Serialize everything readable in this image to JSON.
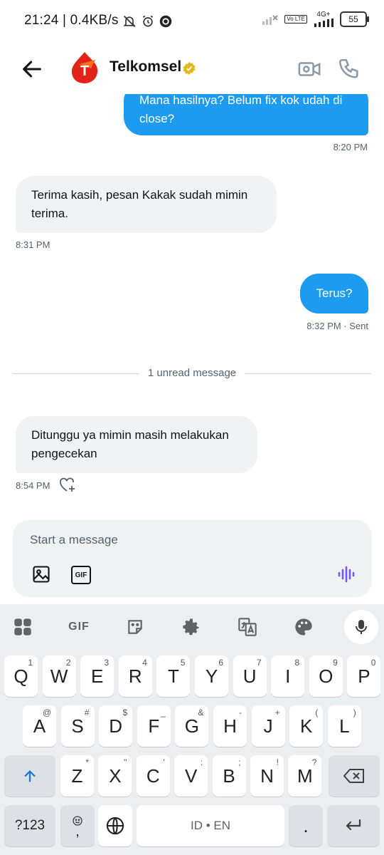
{
  "status_bar": {
    "time": "21:24",
    "speed": "0.4KB/s",
    "volte": "Vo LTE",
    "network": "4G+",
    "battery": "55"
  },
  "header": {
    "title": "Telkomsel",
    "avatar_letter": "T",
    "icons": {
      "back": "back-arrow-icon",
      "video": "video-icon",
      "call": "phone-icon",
      "verified": "verified-badge-icon"
    }
  },
  "messages": [
    {
      "direction": "out",
      "text": "Mana hasilnya? Belum fix kok udah di close?",
      "time": "8:20 PM"
    },
    {
      "direction": "in",
      "text": "Terima kasih, pesan Kakak sudah mimin terima.",
      "time": "8:31 PM"
    },
    {
      "direction": "out",
      "text": "Terus?",
      "time": "8:32 PM · Sent"
    },
    {
      "direction": "in",
      "text": "Ditunggu ya mimin masih melakukan pengecekan",
      "time": "8:54 PM"
    }
  ],
  "unread_divider": "1 unread message",
  "composer": {
    "placeholder": "Start a message",
    "gif_label": "GIF"
  },
  "keyboard": {
    "toolbar_gif": "GIF",
    "row1": [
      {
        "k": "Q",
        "h": "1"
      },
      {
        "k": "W",
        "h": "2"
      },
      {
        "k": "E",
        "h": "3"
      },
      {
        "k": "R",
        "h": "4"
      },
      {
        "k": "T",
        "h": "5"
      },
      {
        "k": "Y",
        "h": "6"
      },
      {
        "k": "U",
        "h": "7"
      },
      {
        "k": "I",
        "h": "8"
      },
      {
        "k": "O",
        "h": "9"
      },
      {
        "k": "P",
        "h": "0"
      }
    ],
    "row2": [
      {
        "k": "A",
        "h": "@"
      },
      {
        "k": "S",
        "h": "#"
      },
      {
        "k": "D",
        "h": "$"
      },
      {
        "k": "F",
        "h": "_"
      },
      {
        "k": "G",
        "h": "&"
      },
      {
        "k": "H",
        "h": "-"
      },
      {
        "k": "J",
        "h": "+"
      },
      {
        "k": "K",
        "h": "("
      },
      {
        "k": "L",
        "h": ")"
      }
    ],
    "row3": [
      {
        "k": "Z",
        "h": "*"
      },
      {
        "k": "X",
        "h": "\""
      },
      {
        "k": "C",
        "h": "'"
      },
      {
        "k": "V",
        "h": ":"
      },
      {
        "k": "B",
        "h": ";"
      },
      {
        "k": "N",
        "h": "!"
      },
      {
        "k": "M",
        "h": "?"
      }
    ],
    "sym": "?123",
    "comma": ",",
    "space": "ID • EN",
    "period": "."
  },
  "colors": {
    "accent": "#1d9bf0",
    "incoming": "#eff3f4",
    "brand_red": "#e2231a",
    "voice": "#7856ff"
  }
}
